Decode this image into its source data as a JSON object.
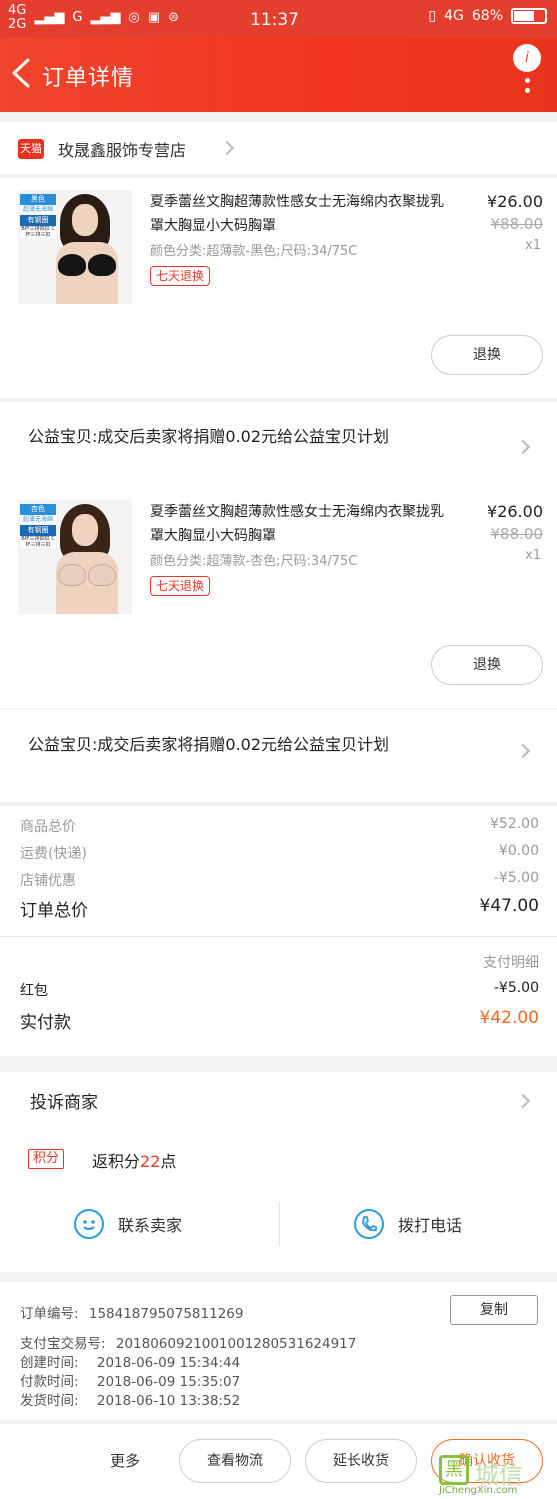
{
  "status_bar": {
    "net1": "4G",
    "net2": "2G",
    "net3": "G",
    "time": "11:37",
    "net_right": "4G",
    "battery": "68%",
    "battery_level": 0.68,
    "color": "#e43f2e"
  },
  "header": {
    "title": "订单详情",
    "notice_badge": "i",
    "accent": "#f2341f"
  },
  "shop": {
    "platform_logo": "天猫",
    "name": "玫晟鑫服饰专营店"
  },
  "items": [
    {
      "thumb_tag": "黑色",
      "thumb_tag_sub": "超薄无海绵",
      "thumb_tag_2": "有钢圈",
      "thumb_tag_3": "B杯三排四扣 C杯三排三扣",
      "name": "夏季蕾丝文胸超薄款性感女士无海绵内衣聚拢乳罩大胸显小大码胸罩",
      "spec": "颜色分类:超薄款-黑色;尺码:34/75C",
      "return_policy": "七天退换",
      "price": "¥26.00",
      "original_price": "¥88.00",
      "quantity": "x1",
      "action": "退换",
      "bra_color": "#151515",
      "hair_color": "#2a1b14"
    },
    {
      "thumb_tag": "杏色",
      "thumb_tag_sub": "超薄无海绵",
      "thumb_tag_2": "有钢圈",
      "thumb_tag_3": "B杯三排四扣 C杯三排三扣",
      "name": "夏季蕾丝文胸超薄款性感女士无海绵内衣聚拢乳罩大胸显小大码胸罩",
      "spec": "颜色分类:超薄款-杏色;尺码:34/75C",
      "return_policy": "七天退换",
      "price": "¥26.00",
      "original_price": "¥88.00",
      "quantity": "x1",
      "action": "退换",
      "bra_color": "#e8d0c0",
      "hair_color": "#3a2418"
    }
  ],
  "charity": [
    {
      "text": "公益宝贝:成交后卖家将捐赠0.02元给公益宝贝计划"
    },
    {
      "text": "公益宝贝:成交后卖家将捐赠0.02元给公益宝贝计划"
    }
  ],
  "summary": {
    "goods_total_label": "商品总价",
    "goods_total": "¥52.00",
    "shipping_label": "运费(快递)",
    "shipping": "¥0.00",
    "discount_label": "店铺优惠",
    "discount": "-¥5.00",
    "order_total_label": "订单总价",
    "order_total": "¥47.00",
    "payment_detail_label": "支付明细",
    "red_packet_label": "红包",
    "red_packet": "-¥5.00",
    "paid_label": "实付款",
    "paid": "¥42.00"
  },
  "actions": {
    "complain": "投诉商家",
    "points_badge": "积分",
    "points_prefix": "返积分",
    "points_value": "22",
    "points_suffix": "点",
    "contact_seller": "联系卖家",
    "call": "拨打电话"
  },
  "order_info": {
    "order_no_label": "订单编号:",
    "order_no": "158418795075811269",
    "copy": "复制",
    "alipay_label": "支付宝交易号:",
    "alipay_no": "2018060921001001280531624917",
    "created_label": "创建时间:",
    "created": "2018-06-09 15:34:44",
    "paid_label": "付款时间:",
    "paid": "2018-06-09 15:35:07",
    "shipped_label": "发货时间:",
    "shipped": "2018-06-10 13:38:52"
  },
  "bottom_bar": {
    "more": "更多",
    "logistics": "查看物流",
    "extend": "延长收货",
    "confirm": "确认收货"
  },
  "watermark": {
    "mark": "黑",
    "text": "城信",
    "url": "JiChengXin.com"
  }
}
